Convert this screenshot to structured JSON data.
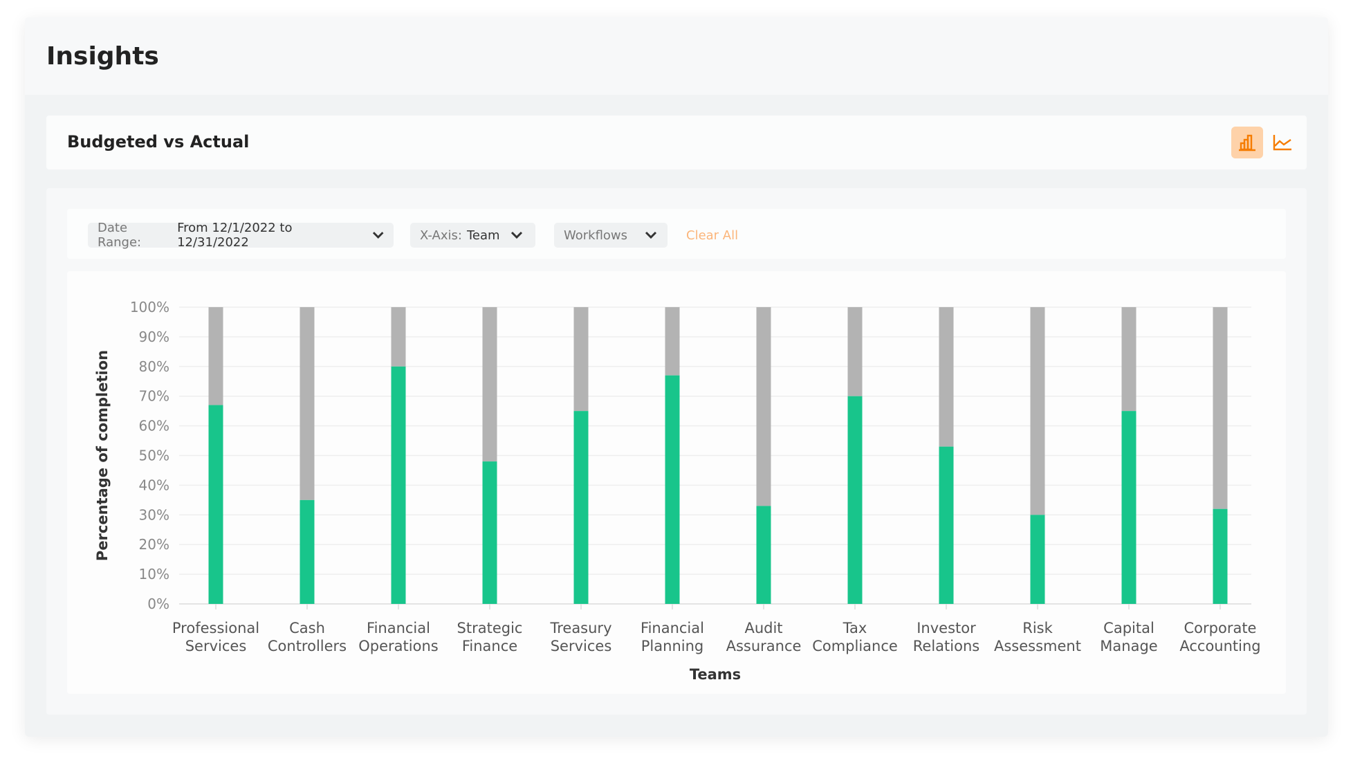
{
  "header": {
    "title": "Insights"
  },
  "card": {
    "title": "Budgeted vs Actual",
    "view_buttons": [
      {
        "icon": "bar-chart-icon",
        "active": true
      },
      {
        "icon": "line-chart-icon",
        "active": false
      }
    ]
  },
  "filters": {
    "date_range": {
      "label": "Date Range:",
      "value": "From 12/1/2022 to 12/31/2022"
    },
    "x_axis": {
      "label": "X-Axis:",
      "value": "Team"
    },
    "workflows": {
      "label": "Workflows"
    },
    "clear_all": "Clear All"
  },
  "colors": {
    "accent": "#f57c00",
    "actual": "#18c58b",
    "budget": "#b3b3b3"
  },
  "chart_data": {
    "type": "bar",
    "stacked": true,
    "xlabel": "Teams",
    "ylabel": "Percentage of completion",
    "ylim": [
      0,
      100
    ],
    "yticks": [
      "0%",
      "10%",
      "20%",
      "30%",
      "40%",
      "50%",
      "60%",
      "70%",
      "80%",
      "90%",
      "100%"
    ],
    "grid": true,
    "categories": [
      [
        "Professional",
        "Services"
      ],
      [
        "Cash",
        "Controllers"
      ],
      [
        "Financial",
        "Operations"
      ],
      [
        "Strategic",
        "Finance"
      ],
      [
        "Treasury",
        "Services"
      ],
      [
        "Financial",
        "Planning"
      ],
      [
        "Audit",
        "Assurance"
      ],
      [
        "Tax",
        "Compliance"
      ],
      [
        "Investor",
        "Relations"
      ],
      [
        "Risk",
        "Assessment"
      ],
      [
        "Capital",
        "Manage"
      ],
      [
        "Corporate",
        "Accounting"
      ]
    ],
    "values": [
      67,
      35,
      80,
      48,
      65,
      77,
      33,
      70,
      53,
      30,
      65,
      32
    ],
    "total": 100
  }
}
